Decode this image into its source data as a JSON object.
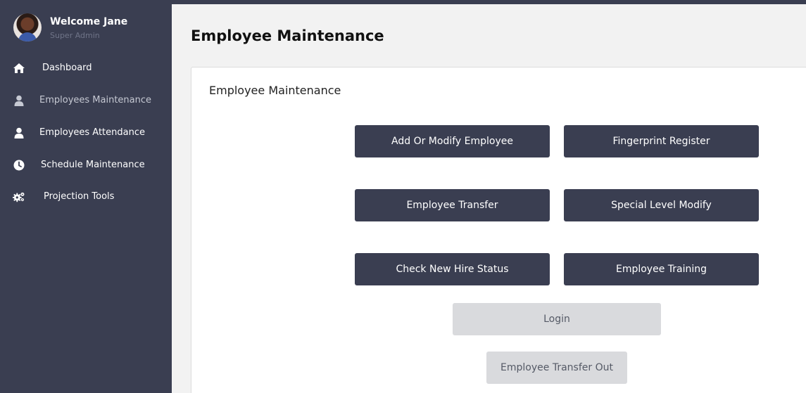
{
  "sidebar": {
    "profile": {
      "welcome": "Welcome Jane",
      "role": "Super Admin",
      "avatar_icon": "user-avatar"
    },
    "items": [
      {
        "label": "Dashboard",
        "icon": "home-icon"
      },
      {
        "label": "Employees Maintenance",
        "icon": "user-icon",
        "active": true
      },
      {
        "label": "Employees Attendance",
        "icon": "user-icon"
      },
      {
        "label": "Schedule Maintenance",
        "icon": "clock-icon"
      },
      {
        "label": "Projection Tools",
        "icon": "gears-icon"
      }
    ]
  },
  "main": {
    "page_title": "Employee Maintenance",
    "card_title": "Employee Maintenance",
    "buttons": [
      {
        "label": "Add Or Modify Employee",
        "style": "dark"
      },
      {
        "label": "Fingerprint Register",
        "style": "dark"
      },
      {
        "label": "Employee Transfer",
        "style": "dark"
      },
      {
        "label": "Special Level Modify",
        "style": "dark"
      },
      {
        "label": "Check New Hire Status",
        "style": "dark"
      },
      {
        "label": "Employee Training",
        "style": "dark"
      },
      {
        "label": "Login",
        "style": "light"
      },
      {
        "label": "Employee Transfer Out",
        "style": "light"
      }
    ]
  },
  "colors": {
    "sidebar_bg": "#3a3e51",
    "main_bg": "#f2f2f2",
    "button_dark": "#3a3e51",
    "button_light": "#d9dadd"
  }
}
